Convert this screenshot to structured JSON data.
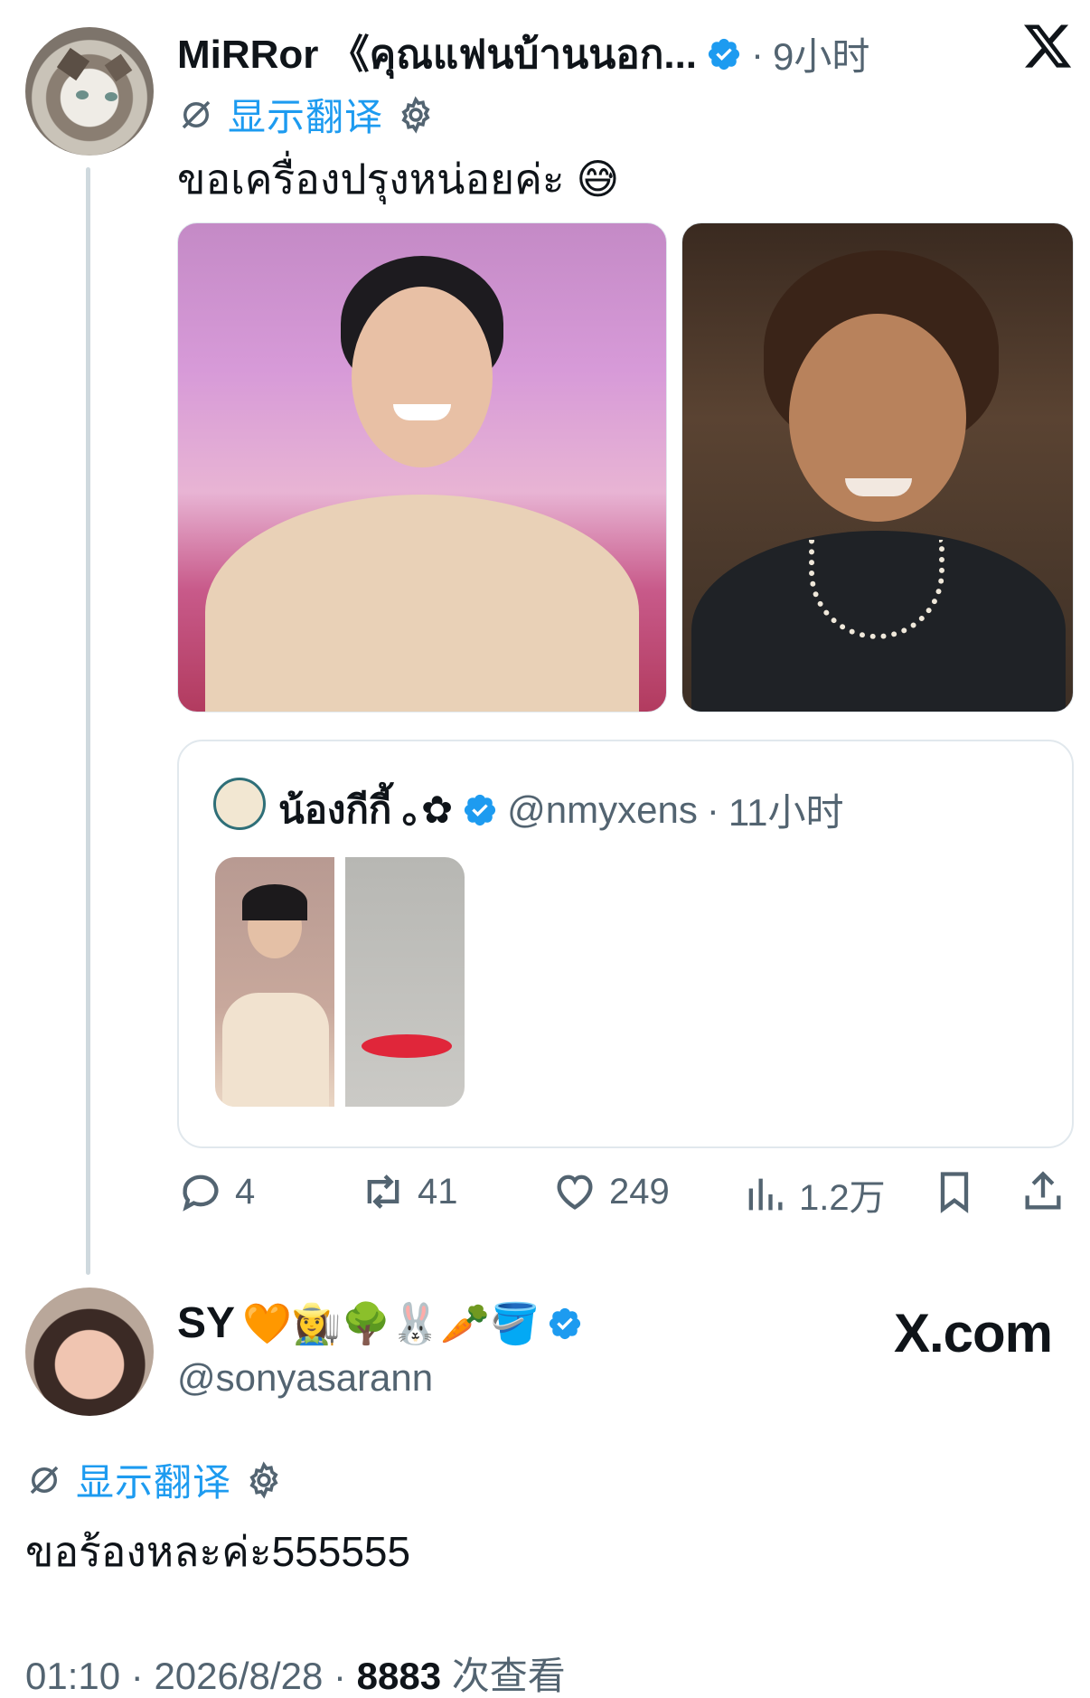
{
  "tweet": {
    "author_name": "MiRRor 《คุณแฟนบ้านนอก...",
    "time": "9小时",
    "translate_label": "显示翻译",
    "text": "ขอเครื่องปรุงหน่อยค่ะ 😅",
    "quote": {
      "name": "น้องกีกี้ ｡✿",
      "handle": "@nmyxens",
      "time": "11小时"
    },
    "actions": {
      "reply_count": "4",
      "retweet_count": "41",
      "like_count": "249",
      "views_count": "1.2万"
    }
  },
  "reply": {
    "author_name": "SY",
    "name_emojis": "🧡👩‍🌾🌳🐰🥕🪣",
    "handle": "@sonyasarann",
    "translate_label": "显示翻译",
    "text": "ขอร้องหละค่ะ555555",
    "watermark": "X.com"
  },
  "footer": {
    "time": "01:10",
    "date": "2026/8/28",
    "views_count": "8883",
    "views_label": "次查看"
  },
  "colors": {
    "accent": "#1d9bf0",
    "text": "#0f1419",
    "muted": "#536471",
    "border": "#e1e8ed"
  }
}
